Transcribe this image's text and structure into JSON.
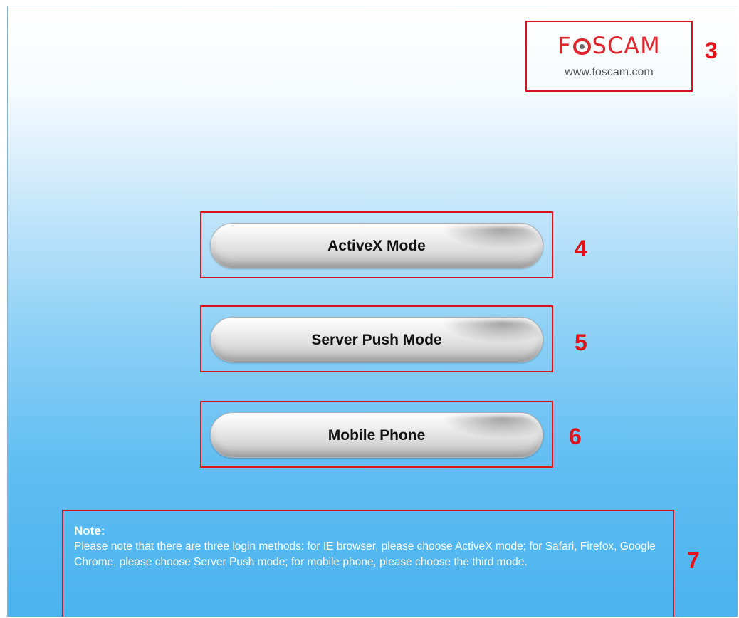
{
  "logo": {
    "brand": "FOSCAM",
    "brand_prefix": "F",
    "brand_suffix": "SCAM",
    "url": "www.foscam.com"
  },
  "buttons": {
    "activex_label": "ActiveX Mode",
    "server_push_label": "Server Push Mode",
    "mobile_label": "Mobile Phone"
  },
  "note": {
    "title": "Note:",
    "text": "Please note that there are three login methods: for IE browser, please choose ActiveX mode; for Safari, Firefox, Google Chrome, please choose Server Push mode; for mobile phone, please choose the third mode."
  },
  "callouts": {
    "logo": "3",
    "activex": "4",
    "server_push": "5",
    "mobile": "6",
    "note": "7"
  },
  "colors": {
    "annotation_red": "#d8141b",
    "brand_red": "#e0262c",
    "background_top": "#ffffff",
    "background_bottom": "#4bb3ef"
  }
}
